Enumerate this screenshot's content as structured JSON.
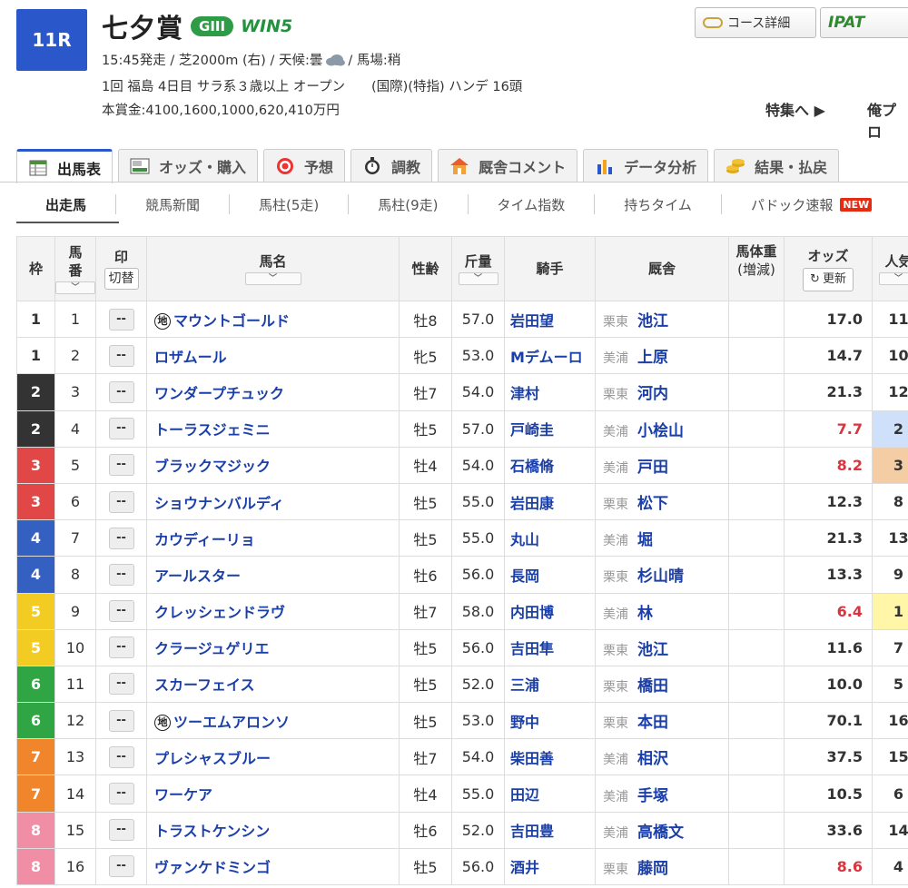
{
  "race": {
    "number": "11R",
    "name": "七夕賞",
    "grade": "GIII",
    "win5": "WIN5",
    "data1_pre": "15:45発走 / 芝2000m (右) / 天候:曇",
    "data1_post": "/ 馬場:稍",
    "data2": "1回 福島 4日目 サラ系３歳以上 オープン　　(国際)(特指) ハンデ 16頭",
    "data3": "本賞金:4100,1600,1000,620,410万円"
  },
  "header_buttons": {
    "course": "コース詳細",
    "ipat": "IPAT"
  },
  "feature_links": {
    "tokushu": "特集へ ▶",
    "oreplo": "俺プロ"
  },
  "tabs": [
    {
      "label": "出馬表",
      "icon": "table-icon"
    },
    {
      "label": "オッズ・購入",
      "icon": "ipat-icon"
    },
    {
      "label": "予想",
      "icon": "target-icon"
    },
    {
      "label": "調教",
      "icon": "stopwatch-icon"
    },
    {
      "label": "厩舎コメント",
      "icon": "stable-icon"
    },
    {
      "label": "データ分析",
      "icon": "bar-chart-icon"
    },
    {
      "label": "結果・払戻",
      "icon": "coins-icon"
    }
  ],
  "subnav": [
    "出走馬",
    "競馬新聞",
    "馬柱(5走)",
    "馬柱(9走)",
    "タイム指数",
    "持ちタイム",
    "パドック速報"
  ],
  "subnav_new": "NEW",
  "columns": {
    "waku": "枠",
    "umaban": "馬番",
    "mark": "印",
    "kirikae": "切替",
    "name": "馬名",
    "sexage": "性齢",
    "weight": "斤量",
    "jockey": "騎手",
    "trainer": "厩舎",
    "bodyweight": "馬体重",
    "bodyweight_sub": "(増減)",
    "odds": "オッズ",
    "koushin": "更新",
    "ninki": "人気",
    "sort_glyph": "﹀"
  },
  "mark_placeholder": "--",
  "chi_mark": "地",
  "horses": [
    {
      "waku": "1",
      "umaban": "1",
      "chi": true,
      "name": "マウントゴールド",
      "sexage": "牡8",
      "weight": "57.0",
      "jockey": "岩田望",
      "area": "栗東",
      "trainer": "池江",
      "odds": "17.0",
      "ninki": "11",
      "hot": false
    },
    {
      "waku": "1",
      "umaban": "2",
      "chi": false,
      "name": "ロザムール",
      "sexage": "牝5",
      "weight": "53.0",
      "jockey": "Mデムーロ",
      "area": "美浦",
      "trainer": "上原",
      "odds": "14.7",
      "ninki": "10",
      "hot": false
    },
    {
      "waku": "2",
      "umaban": "3",
      "chi": false,
      "name": "ワンダープチュック",
      "sexage": "牡7",
      "weight": "54.0",
      "jockey": "津村",
      "area": "栗東",
      "trainer": "河内",
      "odds": "21.3",
      "ninki": "12",
      "hot": false
    },
    {
      "waku": "2",
      "umaban": "4",
      "chi": false,
      "name": "トーラスジェミニ",
      "sexage": "牡5",
      "weight": "57.0",
      "jockey": "戸崎圭",
      "area": "美浦",
      "trainer": "小桧山",
      "odds": "7.7",
      "ninki": "2",
      "hot": true
    },
    {
      "waku": "3",
      "umaban": "5",
      "chi": false,
      "name": "ブラックマジック",
      "sexage": "牡4",
      "weight": "54.0",
      "jockey": "石橋脩",
      "area": "美浦",
      "trainer": "戸田",
      "odds": "8.2",
      "ninki": "3",
      "hot": true
    },
    {
      "waku": "3",
      "umaban": "6",
      "chi": false,
      "name": "ショウナンバルディ",
      "sexage": "牡5",
      "weight": "55.0",
      "jockey": "岩田康",
      "area": "栗東",
      "trainer": "松下",
      "odds": "12.3",
      "ninki": "8",
      "hot": false
    },
    {
      "waku": "4",
      "umaban": "7",
      "chi": false,
      "name": "カウディーリョ",
      "sexage": "牡5",
      "weight": "55.0",
      "jockey": "丸山",
      "area": "美浦",
      "trainer": "堀",
      "odds": "21.3",
      "ninki": "13",
      "hot": false
    },
    {
      "waku": "4",
      "umaban": "8",
      "chi": false,
      "name": "アールスター",
      "sexage": "牡6",
      "weight": "56.0",
      "jockey": "長岡",
      "area": "栗東",
      "trainer": "杉山晴",
      "odds": "13.3",
      "ninki": "9",
      "hot": false
    },
    {
      "waku": "5",
      "umaban": "9",
      "chi": false,
      "name": "クレッシェンドラヴ",
      "sexage": "牡7",
      "weight": "58.0",
      "jockey": "内田博",
      "area": "美浦",
      "trainer": "林",
      "odds": "6.4",
      "ninki": "1",
      "hot": true
    },
    {
      "waku": "5",
      "umaban": "10",
      "chi": false,
      "name": "クラージュゲリエ",
      "sexage": "牡5",
      "weight": "56.0",
      "jockey": "吉田隼",
      "area": "栗東",
      "trainer": "池江",
      "odds": "11.6",
      "ninki": "7",
      "hot": false
    },
    {
      "waku": "6",
      "umaban": "11",
      "chi": false,
      "name": "スカーフェイス",
      "sexage": "牡5",
      "weight": "52.0",
      "jockey": "三浦",
      "area": "栗東",
      "trainer": "橋田",
      "odds": "10.0",
      "ninki": "5",
      "hot": false
    },
    {
      "waku": "6",
      "umaban": "12",
      "chi": true,
      "name": "ツーエムアロンソ",
      "sexage": "牡5",
      "weight": "53.0",
      "jockey": "野中",
      "area": "栗東",
      "trainer": "本田",
      "odds": "70.1",
      "ninki": "16",
      "hot": false
    },
    {
      "waku": "7",
      "umaban": "13",
      "chi": false,
      "name": "プレシャスブルー",
      "sexage": "牡7",
      "weight": "54.0",
      "jockey": "柴田善",
      "area": "美浦",
      "trainer": "相沢",
      "odds": "37.5",
      "ninki": "15",
      "hot": false
    },
    {
      "waku": "7",
      "umaban": "14",
      "chi": false,
      "name": "ワーケア",
      "sexage": "牡4",
      "weight": "55.0",
      "jockey": "田辺",
      "area": "美浦",
      "trainer": "手塚",
      "odds": "10.5",
      "ninki": "6",
      "hot": false
    },
    {
      "waku": "8",
      "umaban": "15",
      "chi": false,
      "name": "トラストケンシン",
      "sexage": "牡6",
      "weight": "52.0",
      "jockey": "吉田豊",
      "area": "美浦",
      "trainer": "高橋文",
      "odds": "33.6",
      "ninki": "14",
      "hot": false
    },
    {
      "waku": "8",
      "umaban": "16",
      "chi": false,
      "name": "ヴァンケドミンゴ",
      "sexage": "牡5",
      "weight": "56.0",
      "jockey": "酒井",
      "area": "栗東",
      "trainer": "藤岡",
      "odds": "8.6",
      "ninki": "4",
      "hot": true
    }
  ]
}
